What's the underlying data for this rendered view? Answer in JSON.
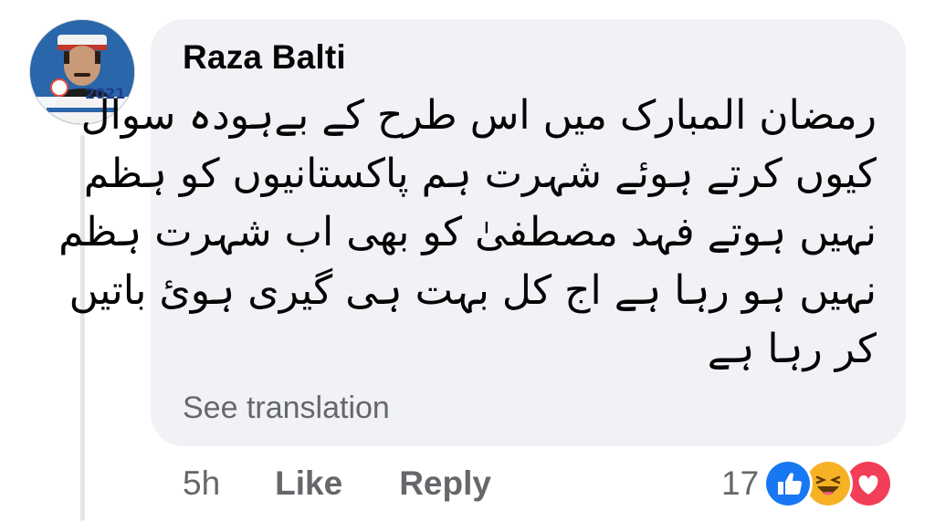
{
  "comment": {
    "author": "Raza Balti",
    "text_lines": [
      "رمضان المبارک میں اس طرح کے بےہودہ سوال",
      "کیوں کرتے ہوئے شہرت ہم پاکستانیوں کو ہظم",
      "نہیں ہوتے فہد مصطفیٰ کو بھی اب شہرت ہظم",
      "نہیں ہو رہا ہے اج کل بہت ہی گیری ہوئ باتیں",
      "کر رہا ہے"
    ],
    "see_translation": "See translation"
  },
  "avatar": {
    "year_text": "2021"
  },
  "actions": {
    "time": "5h",
    "like": "Like",
    "reply": "Reply"
  },
  "reactions": {
    "count": "17",
    "icons": [
      "like-icon",
      "haha-icon",
      "love-icon"
    ]
  },
  "colors": {
    "bubble": "#f0f2f5",
    "text": "#050505",
    "secondary_text": "#65676b",
    "like_blue": "#1877f2",
    "haha_yellow": "#f7b125",
    "love_red": "#f33e58"
  }
}
